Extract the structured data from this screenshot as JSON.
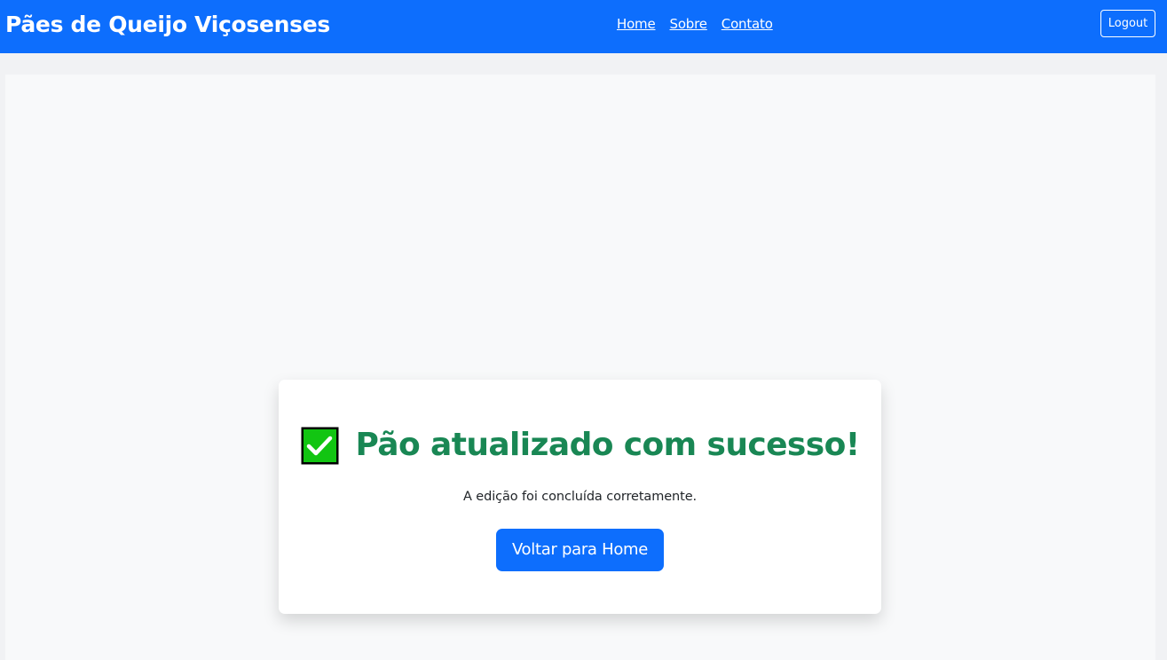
{
  "navbar": {
    "brand": "Pães de Queijo Viçosenses",
    "links": [
      "Home",
      "Sobre",
      "Contato"
    ],
    "logout_label": "Logout"
  },
  "card": {
    "icon": "check-mark-button-icon",
    "title": "Pão atualizado com sucesso!",
    "message": "A edição foi concluída corretamente.",
    "button_label": "Voltar para Home"
  },
  "colors": {
    "primary": "#0d6efd",
    "success_text": "#198754",
    "icon_green": "#12c512",
    "page_bg": "#f1f2f4",
    "content_bg": "#f8f9fa"
  }
}
